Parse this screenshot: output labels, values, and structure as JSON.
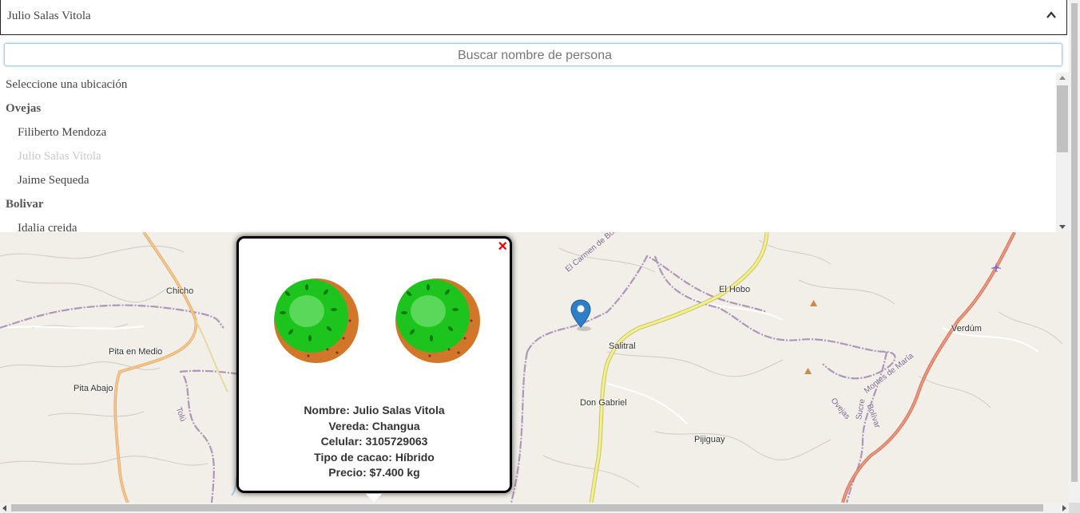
{
  "select": {
    "selected_value": "Julio Salas Vitola",
    "chevron_icon": "chevron-up-icon"
  },
  "search": {
    "placeholder": "Buscar nombre de persona"
  },
  "options": [
    {
      "label": "Seleccione una ubicación",
      "kind": "placeholder"
    },
    {
      "label": "Ovejas",
      "kind": "group"
    },
    {
      "label": "Filiberto Mendoza",
      "kind": "child"
    },
    {
      "label": "Julio Salas Vitola",
      "kind": "child-selected"
    },
    {
      "label": "Jaime Sequeda",
      "kind": "child"
    },
    {
      "label": "Bolivar",
      "kind": "group"
    },
    {
      "label": "Idalia creida",
      "kind": "child"
    }
  ],
  "map": {
    "places": [
      "Chicho",
      "Pita en Medio",
      "Pita Abajo",
      "El Hobo",
      "Salitral",
      "Verdúm",
      "Don Gabriel",
      "Pijiguay"
    ],
    "road_labels": [
      "El Carmen de Bolívar",
      "Montes de María",
      "Ovejas",
      "Bolívar",
      "Sucre",
      "Tolú"
    ],
    "marker_icon": "map-pin-icon",
    "airport_icon": "airplane-icon",
    "peak_icon": "mountain-peak-icon"
  },
  "popup": {
    "close_symbol": "×",
    "image_icon": "kiwi-half-icon",
    "nombre": "Nombre: Julio Salas Vitola",
    "vereda": "Vereda: Changua",
    "celular": "Celular: 3105729063",
    "tipo_cacao": "Tipo de cacao: Híbrido",
    "precio": "Precio: $7.400 kg"
  },
  "colors": {
    "map_bg": "#f2efe9",
    "boundary": "#a78cb4",
    "road_yellow": "#f4f18a",
    "road_orange": "#f4b46a",
    "road_red": "#e8826e",
    "kiwi_green": "#1dc41d",
    "kiwi_skin": "#d2772a",
    "marker_blue": "#2e7fc7",
    "close_red": "#e00000"
  }
}
